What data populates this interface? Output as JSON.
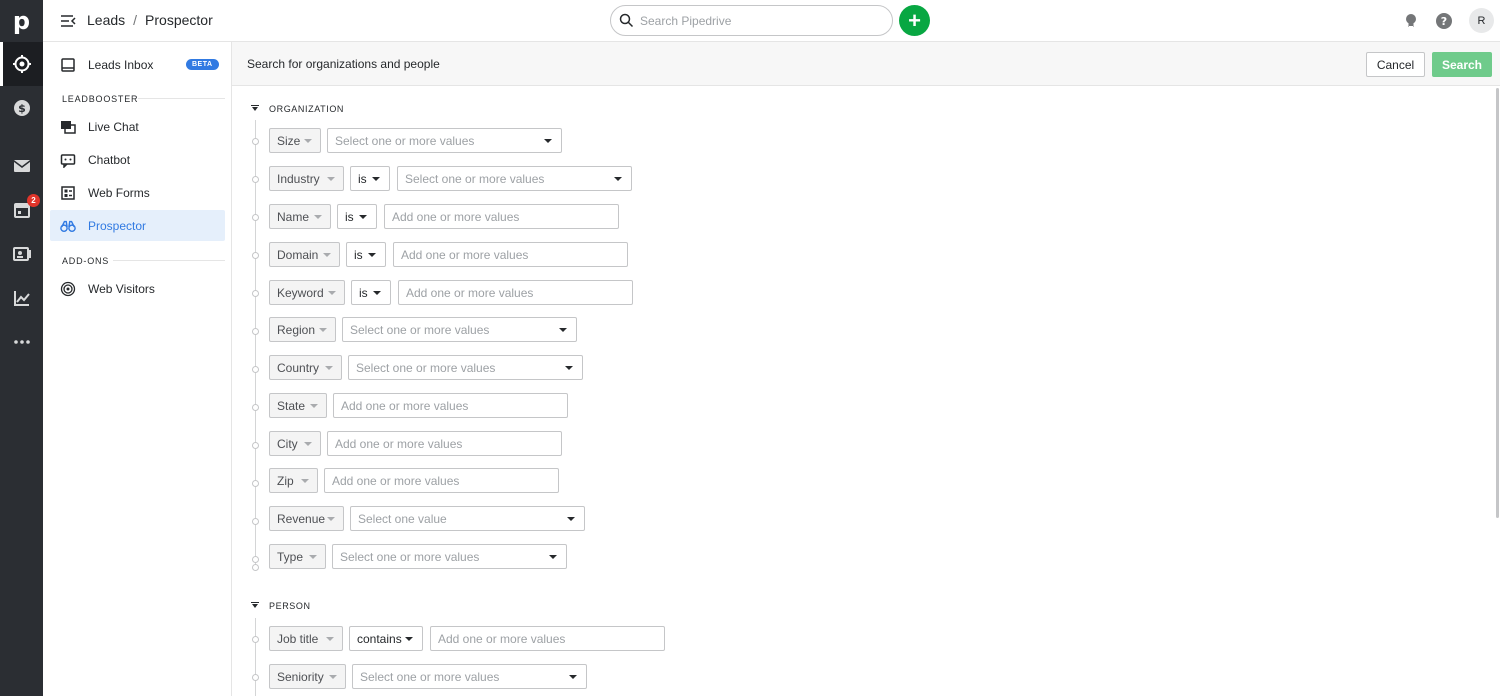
{
  "app": {
    "logo": "p",
    "rail_icons": [
      "leads-icon",
      "deals-icon",
      "mail-icon",
      "calendar-icon",
      "contacts-icon",
      "insights-icon",
      "more-icon"
    ],
    "calendar_badge": "2"
  },
  "topbar": {
    "breadcrumb_parent": "Leads",
    "breadcrumb_sep": "/",
    "breadcrumb_current": "Prospector",
    "search_placeholder": "Search Pipedrive",
    "avatar_initial": "R"
  },
  "sidebar": {
    "leads_inbox": "Leads Inbox",
    "beta": "BETA",
    "leadbooster_header": "LEADBOOSTER",
    "live_chat": "Live Chat",
    "chatbot": "Chatbot",
    "web_forms": "Web Forms",
    "prospector": "Prospector",
    "addons_header": "ADD-ONS",
    "web_visitors": "Web Visitors"
  },
  "main": {
    "title": "Search for organizations and people",
    "cancel": "Cancel",
    "search": "Search",
    "organization_label": "ORGANIZATION",
    "person_label": "PERSON",
    "organization_filters": [
      {
        "field": "Size",
        "op": "",
        "value": "Select one or more values",
        "dropdown": true
      },
      {
        "field": "Industry",
        "op": "is",
        "value": "Select one or more values",
        "dropdown": true
      },
      {
        "field": "Name",
        "op": "is",
        "value": "Add one or more values",
        "dropdown": false
      },
      {
        "field": "Domain",
        "op": "is",
        "value": "Add one or more values",
        "dropdown": false
      },
      {
        "field": "Keyword",
        "op": "is",
        "value": "Add one or more values",
        "dropdown": false
      },
      {
        "field": "Region",
        "op": "",
        "value": "Select one or more values",
        "dropdown": true
      },
      {
        "field": "Country",
        "op": "",
        "value": "Select one or more values",
        "dropdown": true
      },
      {
        "field": "State",
        "op": "",
        "value": "Add one or more values",
        "dropdown": false
      },
      {
        "field": "City",
        "op": "",
        "value": "Add one or more values",
        "dropdown": false
      },
      {
        "field": "Zip",
        "op": "",
        "value": "Add one or more values",
        "dropdown": false
      },
      {
        "field": "Revenue",
        "op": "",
        "value": "Select one value",
        "dropdown": true
      },
      {
        "field": "Type",
        "op": "",
        "value": "Select one or more values",
        "dropdown": true
      }
    ],
    "person_filters": [
      {
        "field": "Job title",
        "op": "contains",
        "value": "Add one or more values",
        "dropdown": false
      },
      {
        "field": "Seniority",
        "op": "",
        "value": "Select one or more values",
        "dropdown": true
      }
    ]
  }
}
